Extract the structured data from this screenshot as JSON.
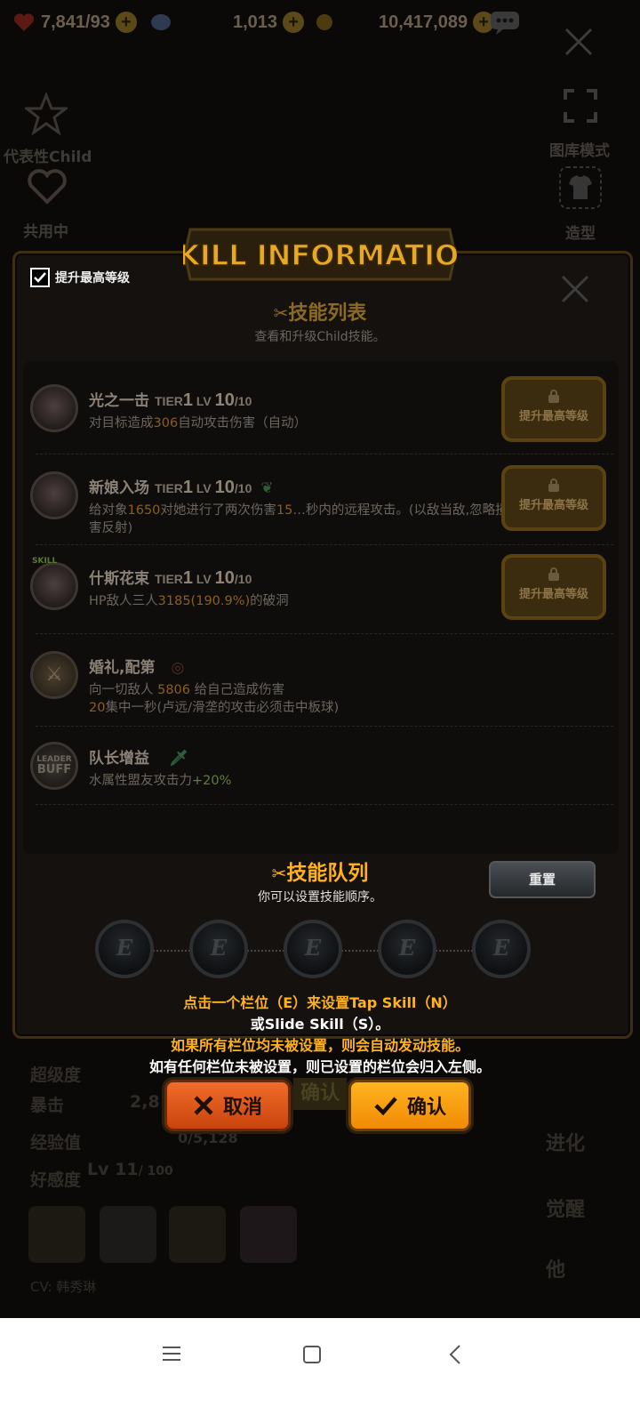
{
  "resources": {
    "hearts": "7,841/93",
    "gems": "1,013",
    "gold": "10,417,089"
  },
  "background": {
    "left_labels": [
      "代表性Child",
      "共用中"
    ],
    "right_labels": [
      "图库模式",
      "造型"
    ],
    "lower_left": [
      "超级度",
      "暴击",
      "经验值",
      "好感度"
    ],
    "lower_values": {
      "crit": "2,8",
      "exp": "0/5,128",
      "affinity_lv": "Lv 11",
      "affinity_max": "/ 100"
    },
    "lower_right": [
      "进化",
      "觉醒",
      "他",
      ""
    ],
    "cv": "CV: 韩秀琳",
    "bg_confirm": "确认"
  },
  "panel": {
    "banner": "SKILL INFORMATION",
    "checkbox_label": "提升最高等级",
    "list_title": "技能列表",
    "list_subtitle": "查看和升级Child技能。"
  },
  "skills": [
    {
      "name": "光之一击",
      "tier": "1",
      "lv": "10",
      "lv_max": "/10",
      "desc_parts": [
        "对目标造成",
        "306",
        "自动攻击伤害（自动）"
      ],
      "button": "提升最高等级"
    },
    {
      "name": "新娘入场",
      "tier": "1",
      "lv": "10",
      "lv_max": "/10",
      "desc_parts": [
        "给对象",
        "1650",
        "对她进行了两次伤害",
        "15",
        "…秒内的远程攻击。(以敌当敌,忽略损害反射)"
      ],
      "button": "提升最高等级"
    },
    {
      "name": "什斯花束",
      "tier": "1",
      "lv": "10",
      "lv_max": "/10",
      "desc_parts": [
        "HP敌人三人",
        "3185(190.9%)",
        "的破洞"
      ],
      "button": "提升最高等级"
    },
    {
      "name": "婚礼,配第",
      "desc_parts": [
        "向一切敌人 ",
        "5806",
        " 给自己造成伤害",
        "20",
        "集中一秒(卢远/滑垄的攻击必须击中板球)"
      ]
    },
    {
      "name": "队长增益",
      "desc_parts": [
        "水属性盟友攻击力",
        "+20%"
      ]
    }
  ],
  "tier_word": "TIER",
  "lv_word": "LV",
  "avatar_badges": {
    "leader": "LEADER",
    "buff": "BUFF",
    "skill": "SKILL"
  },
  "queue": {
    "title": "技能队列",
    "subtitle": "你可以设置技能顺序。",
    "reset": "重置",
    "slots": [
      "E",
      "E",
      "E",
      "E",
      "E"
    ]
  },
  "instructions": {
    "line1": "点击一个栏位（E）来设置Tap Skill（N）",
    "line2": "或Slide Skill（S）。",
    "line3": "如果所有栏位均未被设置，则会自动发动技能。",
    "line4": "如有任何栏位未被设置，则已设置的栏位会归入左侧。"
  },
  "buttons": {
    "cancel": "取消",
    "confirm": "确认"
  },
  "colors": {
    "accent_gold": "#ffb21e",
    "cancel_orange": "#e85a1b"
  },
  "icons": [
    "heart-icon",
    "gem-icon",
    "coin-icon",
    "chat-icon",
    "close-icon",
    "star-icon",
    "expand-icon",
    "shirt-icon",
    "lock-icon",
    "skill-icon",
    "check-icon"
  ]
}
